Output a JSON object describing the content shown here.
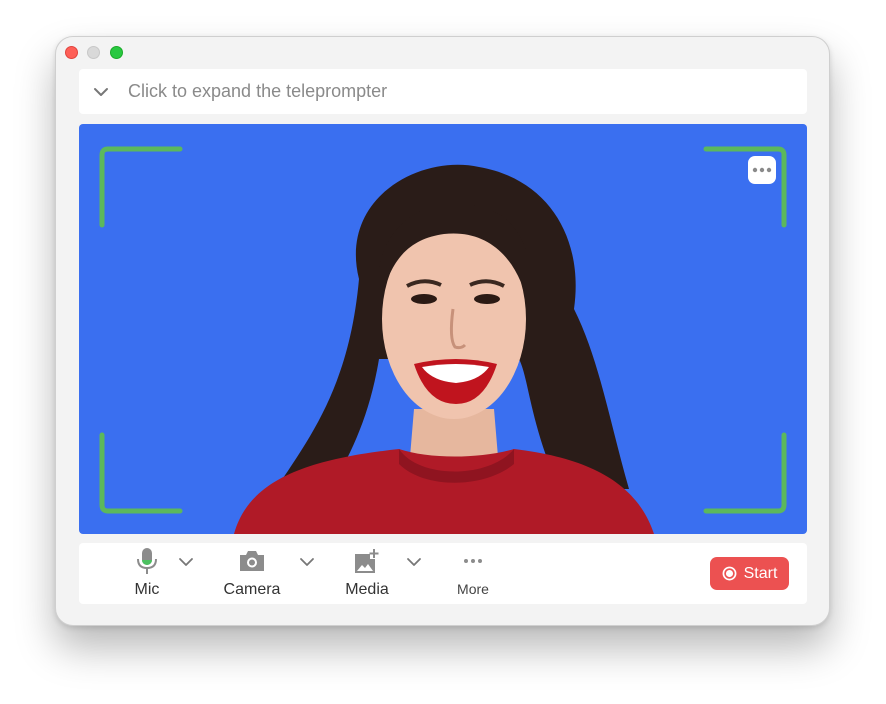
{
  "window": {
    "controls": [
      "close",
      "minimize",
      "maximize"
    ]
  },
  "teleprompter": {
    "label": "Click to expand the teleprompter",
    "icon": "chevron-down-icon"
  },
  "video": {
    "background_color": "#3a6ff0",
    "frame_color": "#5cb85c",
    "more_icon": "more-horizontal-icon",
    "subject": "smiling woman with dark wavy hair in red top"
  },
  "toolbar": {
    "items": [
      {
        "label": "Mic",
        "icon": "microphone-icon",
        "has_dropdown": true
      },
      {
        "label": "Camera",
        "icon": "camera-icon",
        "has_dropdown": true
      },
      {
        "label": "Media",
        "icon": "add-image-icon",
        "has_dropdown": true
      },
      {
        "label": "More",
        "icon": "more-horizontal-icon",
        "has_dropdown": false
      }
    ],
    "start_label": "Start",
    "start_color": "#ec5151"
  }
}
